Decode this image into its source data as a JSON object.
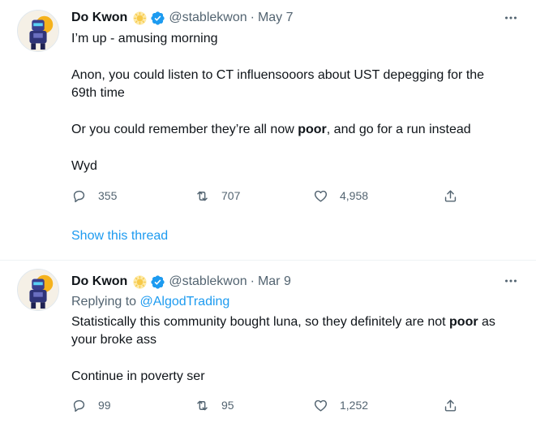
{
  "tweets": [
    {
      "author": {
        "name": "Do Kwon",
        "handle": "@stablekwon"
      },
      "date": "May 7",
      "lines": [
        "I’m up - amusing morning",
        "Anon, you could listen to CT influensooors about UST depegging for the",
        "69th time",
        "Or you could remember they’re all now ",
        "poor",
        ", and go for a run instead",
        "Wyd"
      ],
      "stats": {
        "replies": "355",
        "retweets": "707",
        "likes": "4,958"
      },
      "show_thread": "Show this thread"
    },
    {
      "author": {
        "name": "Do Kwon",
        "handle": "@stablekwon"
      },
      "date": "Mar 9",
      "replying_label": "Replying to ",
      "replying_handle": "@AlgodTrading",
      "lines": [
        "Statistically this community bought luna, so they definitely are not ",
        "poor",
        " as",
        "your broke ass",
        "Continue in poverty ser"
      ],
      "stats": {
        "replies": "99",
        "retweets": "95",
        "likes": "1,252"
      }
    }
  ],
  "separator": "·",
  "colors": {
    "accent": "#1d9bf0",
    "muted": "#536471",
    "text": "#0f1419",
    "sun_badge": "#f7c948"
  },
  "icons": [
    "avatar-robot",
    "sun-badge-icon",
    "verified-icon",
    "more-icon",
    "reply-icon",
    "retweet-icon",
    "like-icon",
    "share-icon"
  ]
}
